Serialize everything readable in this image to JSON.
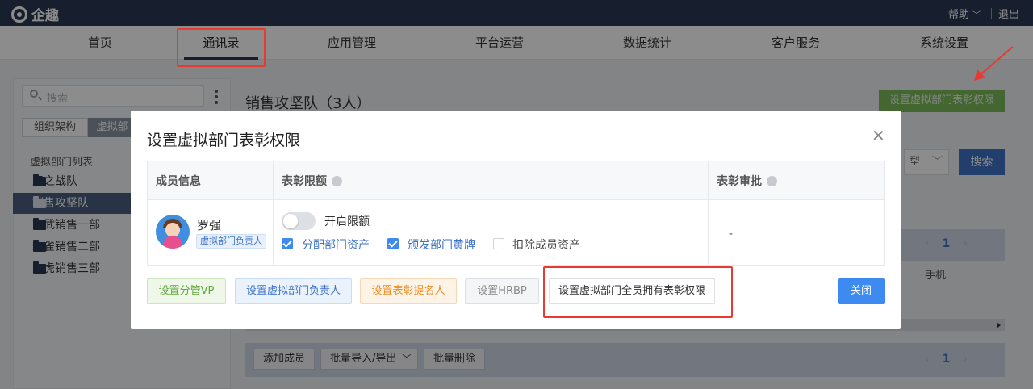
{
  "app": {
    "logo": "企趣",
    "help": "帮助",
    "logout": "退出"
  },
  "nav": [
    "首页",
    "通讯录",
    "应用管理",
    "平台运营",
    "数据统计",
    "客户服务",
    "系统设置"
  ],
  "sidebar": {
    "search_placeholder": "搜索",
    "tabs": [
      "组织架构",
      "虚拟部"
    ],
    "list_title": "虚拟部门列表",
    "items": [
      "王之战队",
      "销售攻坚队",
      "玄武销售一部",
      "朱雀销售二部",
      "白虎销售三部"
    ],
    "selected": "销售攻坚队"
  },
  "main": {
    "title": "销售攻坚队（3人）",
    "set_permission_button": "设置虚拟部门表彰权限",
    "filter_value": "型",
    "search_button": "搜索",
    "pager_top": "1",
    "column_phone": "手机",
    "pager_bottom": "1",
    "footer_buttons": [
      "添加成员",
      "批量导入/导出",
      "批量删除"
    ]
  },
  "modal": {
    "title": "设置虚拟部门表彰权限",
    "columns": [
      "成员信息",
      "表彰限额",
      "表彰审批"
    ],
    "member": {
      "name": "罗强",
      "tag": "虚拟部门负责人"
    },
    "quota_toggle_label": "开启限额",
    "quota_toggle_on": false,
    "checks": [
      {
        "label": "分配部门资产",
        "checked": true
      },
      {
        "label": "颁发部门黄牌",
        "checked": true
      },
      {
        "label": "扣除成员资产",
        "checked": false
      }
    ],
    "approval_value": "-",
    "buttons": [
      "设置分管VP",
      "设置虚拟部门负责人",
      "设置表彰提名人",
      "设置HRBP",
      "设置虚拟部门全员拥有表彰权限"
    ],
    "close_button": "关闭"
  },
  "colors": {
    "topbar": "#2b3a55",
    "primary": "#3d8af0",
    "highlight": "#e83a30",
    "green": "#7cba5a"
  }
}
